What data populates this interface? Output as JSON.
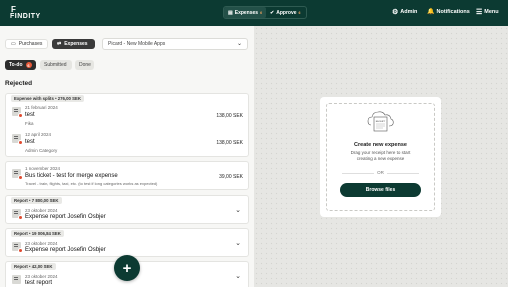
{
  "header": {
    "logo": "FINDITY",
    "tabs": [
      {
        "label": "Expenses",
        "badge": "6"
      },
      {
        "label": "Approve",
        "badge": "6"
      }
    ],
    "admin": "Admin",
    "notifications": "Notifications",
    "menu": "Menu"
  },
  "toolbar": {
    "purchases": "Purchases",
    "expenses": "Expenses",
    "select_value": "Picard - New Mobile Apps"
  },
  "filters": {
    "todo": "To-do",
    "todo_count": "6",
    "submitted": "Submitted",
    "done": "Done"
  },
  "section": "Rejected",
  "cards": [
    {
      "tag": "Expense with splits • 276,00 SEK",
      "items": [
        {
          "date": "21 februari 2024",
          "name": "test",
          "sub": "Fika",
          "amount": "138,00 SEK"
        },
        {
          "date": "12 april 2024",
          "name": "test",
          "sub": "Admin Category",
          "amount": "138,00 SEK"
        }
      ]
    },
    {
      "date": "1 november 2024",
      "name": "Bus ticket - test for merge expense",
      "sub": "Travel - train, flights, taxi, etc. (to test if long categories works as expected)",
      "amount": "39,00 SEK"
    },
    {
      "tag": "Report • 7 800,00 SEK",
      "date": "23 oktober 2024",
      "name": "Expense report Josefin Osbjer"
    },
    {
      "tag": "Report • 19 006,84 SEK",
      "date": "23 oktober 2024",
      "name": "Expense report Josefin Osbjer"
    },
    {
      "tag": "Report • 42,00 SEK",
      "date": "23 oktober 2024",
      "name": "test report"
    }
  ],
  "upload": {
    "title": "Create new expense",
    "desc1": "Drag your receipt here to start",
    "desc2": "creating a new expense",
    "or": "OR",
    "browse": "Browse files",
    "receipt_text": "RECEIPT"
  },
  "colors": {
    "brand": "#0c3a32",
    "alert": "#e04a2f",
    "badge": "#f0a35e"
  }
}
